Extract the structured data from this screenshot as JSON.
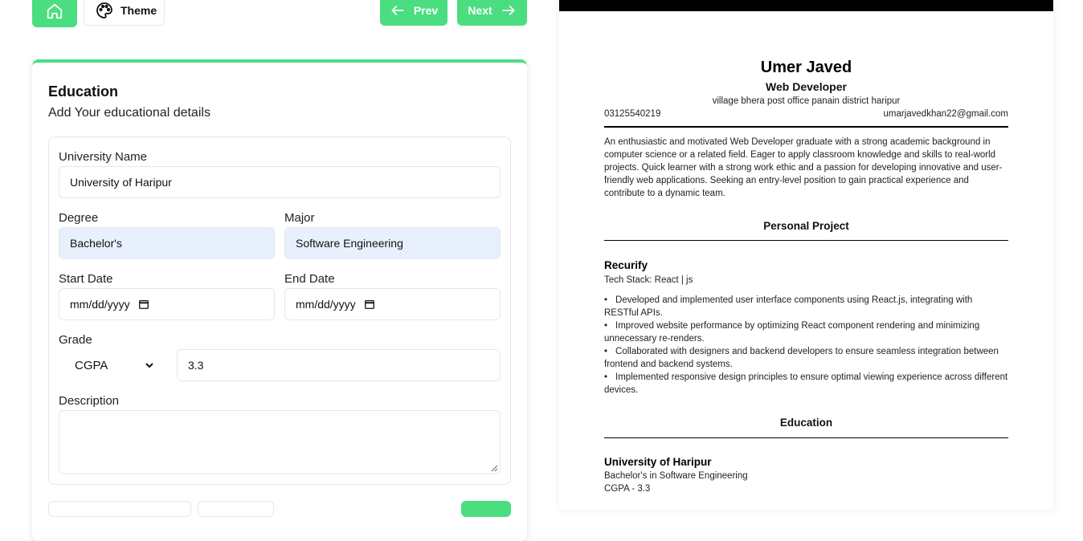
{
  "toolbar": {
    "theme_label": "Theme",
    "prev_label": "Prev",
    "next_label": "Next"
  },
  "colors": {
    "accent": "#4ade80",
    "autofill": "#e8f0fe"
  },
  "form": {
    "title": "Education",
    "subtitle": "Add Your educational details",
    "university_label": "University Name",
    "university_value": "University of Haripur",
    "degree_label": "Degree",
    "degree_value": "Bachelor's",
    "major_label": "Major",
    "major_value": "Software Engineering",
    "start_label": "Start Date",
    "start_placeholder": "mm/dd/yyyy",
    "end_label": "End Date",
    "end_placeholder": "mm/dd/yyyy",
    "grade_label": "Grade",
    "grade_type": "CGPA",
    "grade_value": "3.3",
    "description_label": "Description",
    "description_value": ""
  },
  "resume": {
    "name": "Umer Javed",
    "title": "Web Developer",
    "address": "village bhera post office panain district haripur",
    "phone": "03125540219",
    "email": "umarjavedkhan22@gmail.com",
    "summary": "An enthusiastic and motivated Web Developer graduate with a strong academic background in computer science or a related field. Eager to apply classroom knowledge and skills to real-world projects. Quick learner with a strong work ethic and a passion for developing innovative and user-friendly web applications. Seeking an entry-level position to gain practical experience and contribute to a dynamic team.",
    "project_heading": "Personal Project",
    "project_name": "Recurify",
    "project_stack": "Tech Stack: React | js",
    "project_bullets": [
      "Developed and implemented user interface components using React.js, integrating with RESTful APIs.",
      "Improved website performance by optimizing React component rendering and minimizing unnecessary re-renders.",
      "Collaborated with designers and backend developers to ensure seamless integration between frontend and backend systems.",
      "Implemented responsive design principles to ensure optimal viewing experience across different devices."
    ],
    "education_heading": "Education",
    "edu_university": "University of Haripur",
    "edu_degree": "Bachelor's in Software Engineering",
    "edu_grade": "CGPA - 3.3"
  }
}
